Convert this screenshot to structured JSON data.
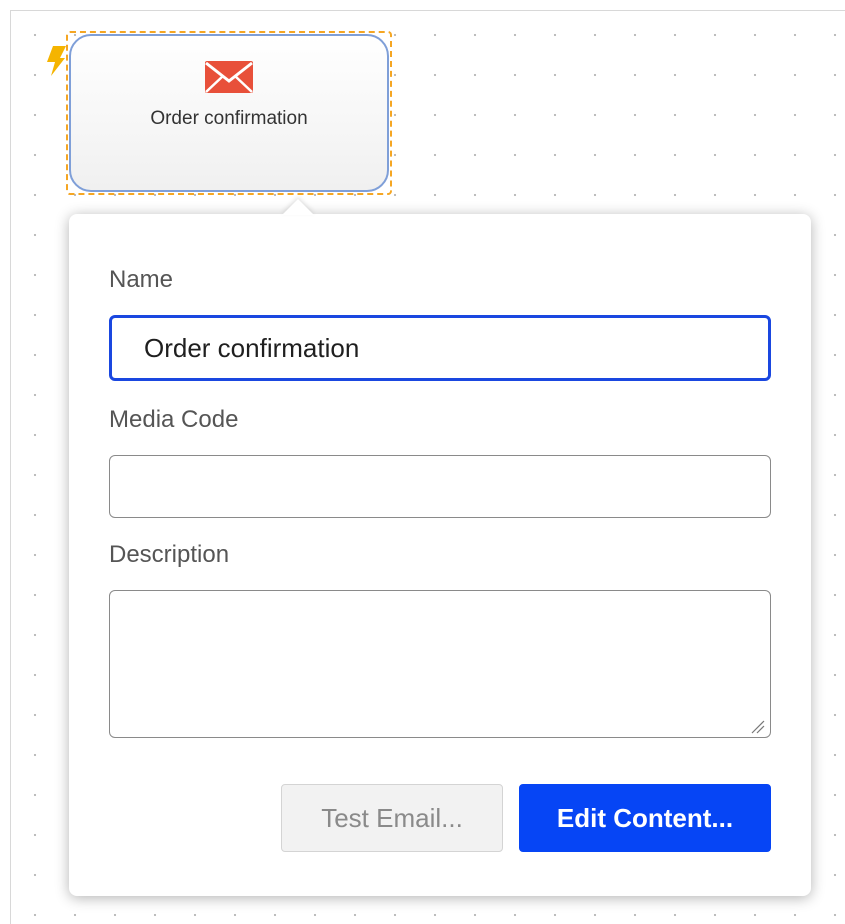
{
  "node": {
    "label": "Order confirmation",
    "icon": "envelope-icon",
    "trigger_icon": "lightning-bolt-icon",
    "icon_color": "#e8503a",
    "selection_color": "#f5a623"
  },
  "form": {
    "name_label": "Name",
    "name_value": "Order confirmation",
    "media_code_label": "Media Code",
    "media_code_value": "",
    "description_label": "Description",
    "description_value": ""
  },
  "buttons": {
    "test_email_label": "Test Email...",
    "edit_content_label": "Edit Content..."
  },
  "colors": {
    "primary": "#0645f5",
    "focus_border": "#1a47e0"
  }
}
